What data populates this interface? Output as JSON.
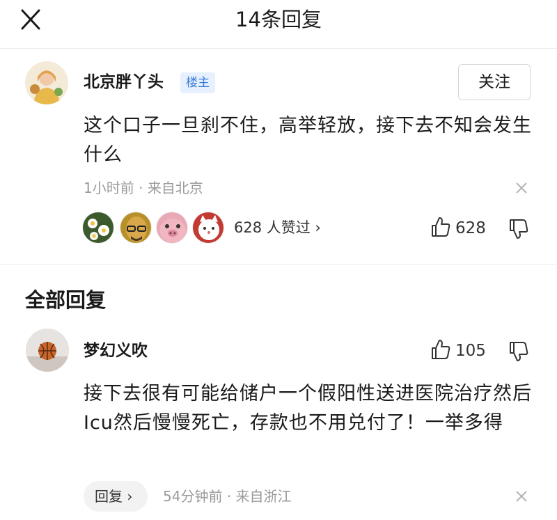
{
  "header": {
    "title": "14条回复",
    "close_icon": "close-icon"
  },
  "main_comment": {
    "author": "北京胖丫头",
    "badge": "楼主",
    "follow_label": "关注",
    "text": "这个口子一旦刹不住，高举轻放，接下去不知会发生什么",
    "time": "1小时前",
    "separator": "·",
    "location": "来自北京",
    "likes_summary": "628 人赞过 ›",
    "like_count": "628",
    "liker_avatars": [
      "narcissus-flower-avatar",
      "bald-man-glasses-avatar",
      "pink-pig-avatar",
      "cartoon-cat-avatar"
    ]
  },
  "section": {
    "title": "全部回复"
  },
  "reply": {
    "author": "梦幻义吹",
    "like_count": "105",
    "text": "接下去很有可能给储户一个假阳性送进医院治疗然后Icu然后慢慢死亡，存款也不用兑付了！一举多得",
    "reply_label": "回复 ›",
    "time": "54分钟前",
    "separator": "·",
    "location": "来自浙江"
  },
  "colors": {
    "badge_bg": "#e6f0ff",
    "badge_text": "#3a7bd5",
    "meta_text": "#9a9a9a",
    "divider": "#ececec"
  }
}
